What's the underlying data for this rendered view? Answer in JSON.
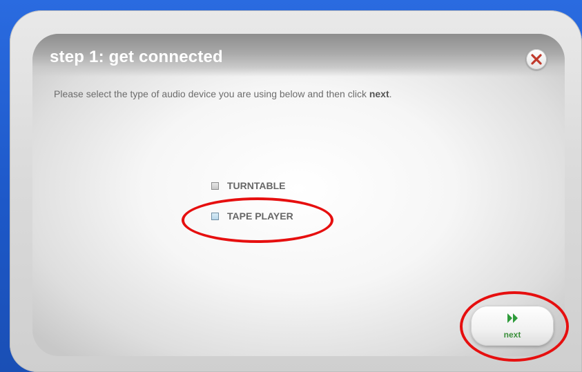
{
  "dialog": {
    "title": "step 1: get connected",
    "instruction_prefix": "Please select the type of audio device you are using below and then click ",
    "instruction_bold": "next",
    "instruction_suffix": ".",
    "close_icon": "close-x-icon"
  },
  "options": [
    {
      "label": "TURNTABLE",
      "checked": false
    },
    {
      "label": "TAPE PLAYER",
      "checked": false,
      "highlighted": true
    }
  ],
  "next_button": {
    "label": "next",
    "icon": "fast-forward-icon"
  },
  "colors": {
    "desktop_blue": "#1f5fd1",
    "title_text": "#ffffff",
    "close_x": "#c0392b",
    "next_green": "#3a8f3a",
    "annotation_red": "#e60f0f"
  }
}
